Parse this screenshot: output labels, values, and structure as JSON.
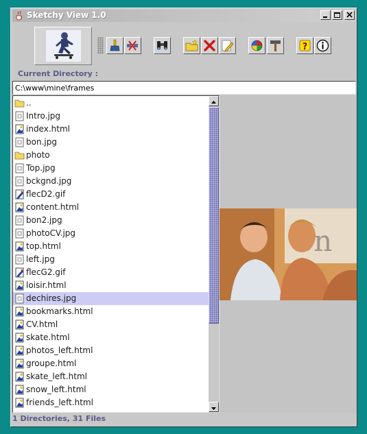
{
  "window": {
    "title": "Sketchy View 1.0",
    "icon": "java-cup-icon"
  },
  "titlebar_buttons": [
    "minimize",
    "maximize",
    "close"
  ],
  "toolbar": {
    "logo": "skateboarder-logo",
    "buttons": [
      {
        "name": "clean-brush-button",
        "icon": "brush-icon"
      },
      {
        "name": "disconnect-button",
        "icon": "unplug-icon"
      },
      {
        "name": "find-button",
        "icon": "binoculars-icon"
      },
      {
        "name": "new-folder-button",
        "icon": "folder-star-icon"
      },
      {
        "name": "delete-button",
        "icon": "red-x-icon"
      },
      {
        "name": "edit-button",
        "icon": "pencil-icon"
      },
      {
        "name": "color-button",
        "icon": "color-wheel-icon"
      },
      {
        "name": "tools-button",
        "icon": "hammer-icon"
      },
      {
        "name": "help-button",
        "icon": "question-icon"
      },
      {
        "name": "info-button",
        "icon": "info-icon"
      }
    ]
  },
  "current_directory": {
    "label": "Current Directory :",
    "path": "C:\\www\\mine\\frames"
  },
  "files": [
    {
      "name": "..",
      "type": "folder"
    },
    {
      "name": "Intro.jpg",
      "type": "image"
    },
    {
      "name": "index.html",
      "type": "html"
    },
    {
      "name": "bon.jpg",
      "type": "image"
    },
    {
      "name": "photo",
      "type": "folder"
    },
    {
      "name": "Top.jpg",
      "type": "image"
    },
    {
      "name": "bckgnd.jpg",
      "type": "image"
    },
    {
      "name": "flecD2.gif",
      "type": "gif"
    },
    {
      "name": "content.html",
      "type": "html"
    },
    {
      "name": "bon2.jpg",
      "type": "image"
    },
    {
      "name": "photoCV.jpg",
      "type": "image"
    },
    {
      "name": "top.html",
      "type": "html"
    },
    {
      "name": "left.jpg",
      "type": "image"
    },
    {
      "name": "flecG2.gif",
      "type": "gif"
    },
    {
      "name": "loisir.html",
      "type": "html"
    },
    {
      "name": "dechires.jpg",
      "type": "image",
      "selected": true
    },
    {
      "name": "bookmarks.html",
      "type": "html"
    },
    {
      "name": "CV.html",
      "type": "html"
    },
    {
      "name": "skate.html",
      "type": "html"
    },
    {
      "name": "photos_left.html",
      "type": "html"
    },
    {
      "name": "groupe.html",
      "type": "html"
    },
    {
      "name": "skate_left.html",
      "type": "html"
    },
    {
      "name": "snow_left.html",
      "type": "html"
    },
    {
      "name": "friends_left.html",
      "type": "html"
    }
  ],
  "preview": {
    "content": "preview-photo",
    "description": ""
  },
  "status": {
    "text": "1 Directories, 31 Files"
  },
  "colors": {
    "desktop": "#0b8a8a",
    "window": "#c8c8c8",
    "selection": "#ccccf4",
    "label_text": "#5a5a8a",
    "scroll_thumb": "#a8a8d8"
  }
}
